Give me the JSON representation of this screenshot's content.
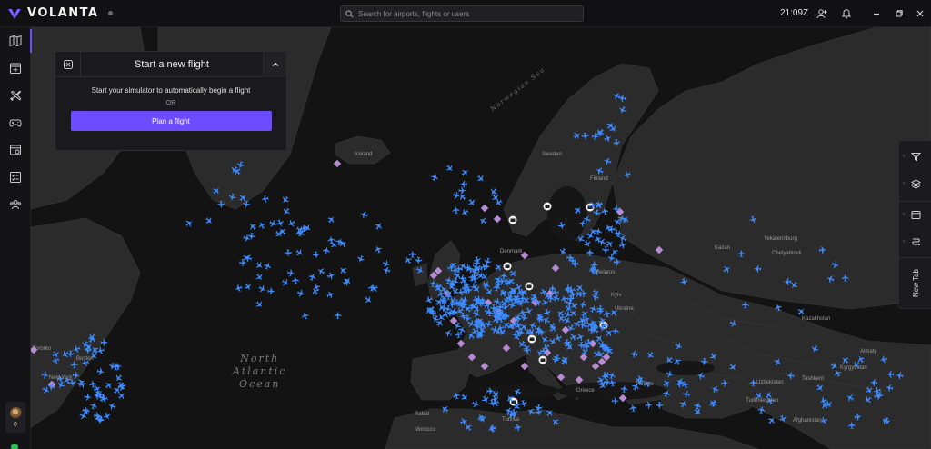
{
  "app": {
    "name": "VOLANTA"
  },
  "search": {
    "placeholder": "Search for airports, flights or users"
  },
  "clock": "21:09Z",
  "sidebar": {
    "items": [
      {
        "name": "map-icon"
      },
      {
        "name": "planned-flights-icon"
      },
      {
        "name": "aircraft-icon"
      },
      {
        "name": "gamepad-icon"
      },
      {
        "name": "logbook-icon"
      },
      {
        "name": "checklist-icon"
      },
      {
        "name": "community-icon"
      }
    ],
    "user_count": "0"
  },
  "panel": {
    "title": "Start a new flight",
    "message": "Start your simulator to automatically begin a flight",
    "or": "OR",
    "plan_button": "Plan a flight"
  },
  "right_toolbar": {
    "items": [
      {
        "name": "filter-icon"
      },
      {
        "name": "layers-icon"
      },
      {
        "name": "window-icon"
      },
      {
        "name": "route-icon"
      }
    ],
    "new_tab": "New Tab"
  },
  "map": {
    "ocean_label": [
      "North",
      "Atlantic",
      "Ocean"
    ],
    "sea_label": "Norwegian Sea",
    "places": [
      "Iceland",
      "Sweden",
      "Finland",
      "Denmark",
      "Belarus",
      "Ukraine",
      "Kyiv",
      "Kazakhstan",
      "Kazan",
      "Yekaterinburg",
      "Chelyabinsk",
      "Almaty",
      "Kyrgyzstan",
      "Uzbekistan",
      "Tashkent",
      "Turkmenistan",
      "Afghanistan",
      "Türkiye",
      "Greece",
      "Tunisia",
      "Rabat",
      "Morocco",
      "Toronto",
      "New York",
      "Boston"
    ]
  },
  "colors": {
    "accent": "#6b4cff",
    "plane": "#3d8bff",
    "airport": "#c08ad8",
    "online": "#26c251"
  }
}
